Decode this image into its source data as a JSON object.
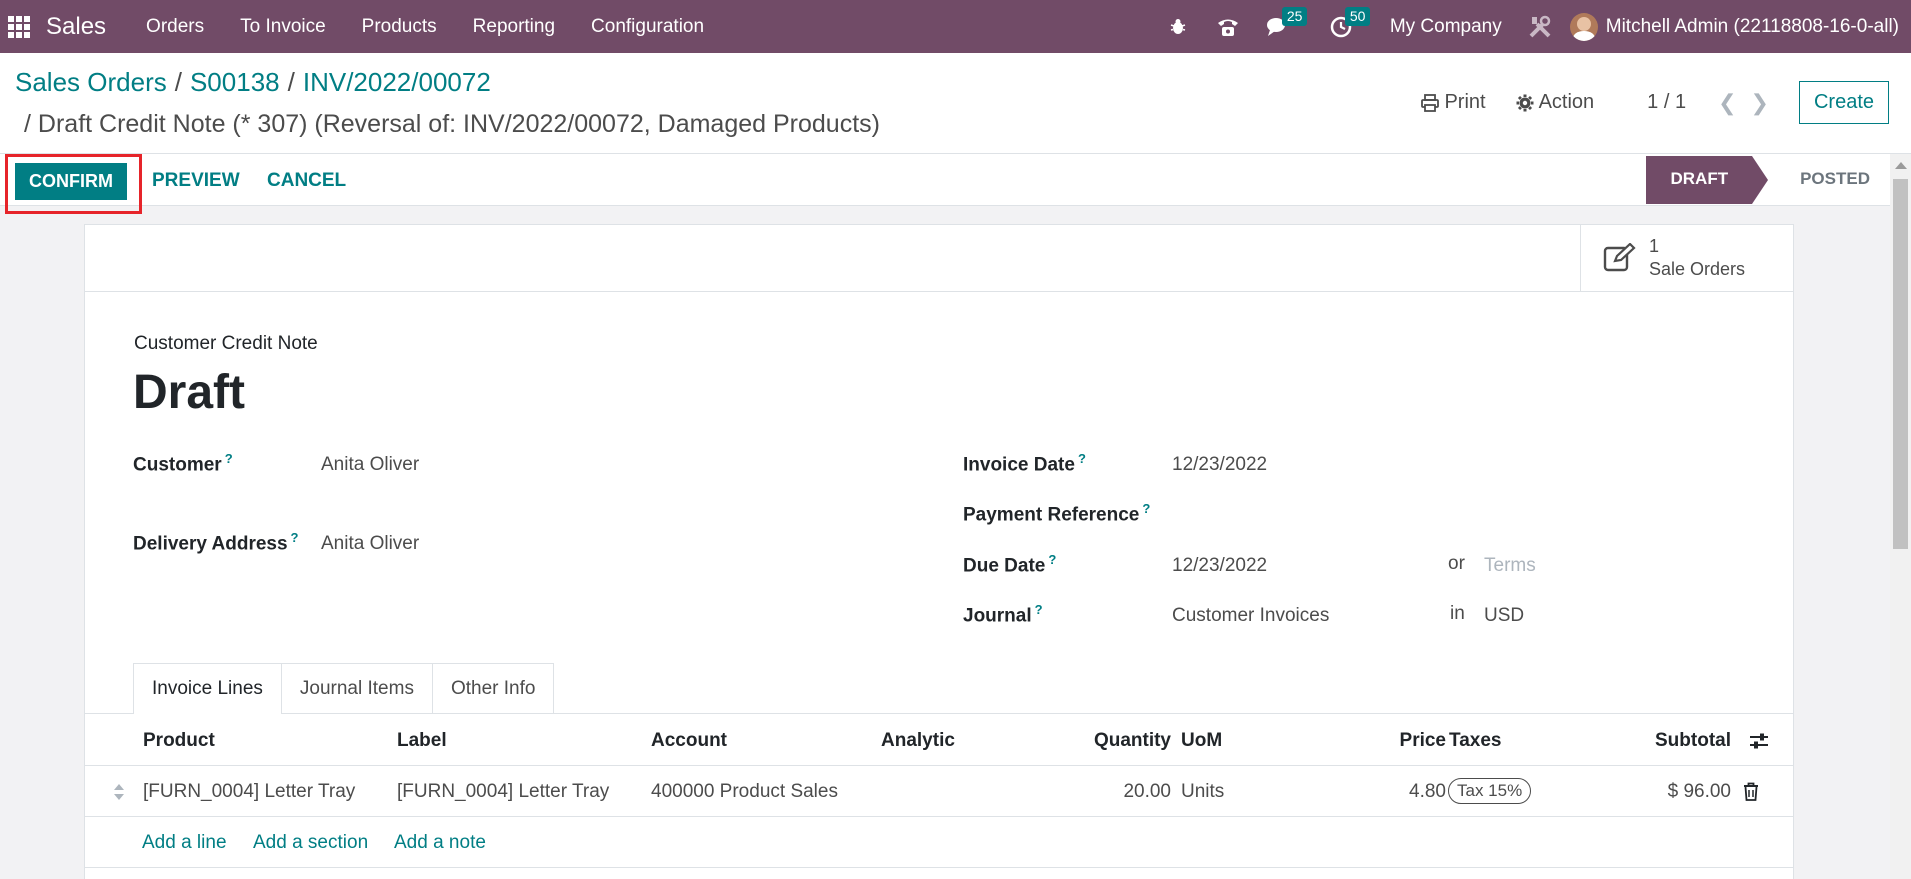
{
  "navbar": {
    "brand": "Sales",
    "menu": [
      "Orders",
      "To Invoice",
      "Products",
      "Reporting",
      "Configuration"
    ],
    "messages_count": "25",
    "activities_count": "50",
    "company": "My Company",
    "user": "Mitchell Admin (22118808-16-0-all)",
    "bg_color": "#714b67"
  },
  "breadcrumb": {
    "items": [
      "Sales Orders",
      "S00138",
      "INV/2022/00072"
    ],
    "current": "Draft Credit Note (* 307) (Reversal of: INV/2022/00072, Damaged Products)"
  },
  "control": {
    "print_label": "Print",
    "action_label": "Action",
    "pager": "1 / 1",
    "create_label": "Create"
  },
  "statusbar": {
    "confirm_label": "CONFIRM",
    "preview_label": "PREVIEW",
    "cancel_label": "CANCEL",
    "stage_active": "DRAFT",
    "stage_next": "POSTED"
  },
  "smart_button": {
    "count": "1",
    "label": "Sale Orders"
  },
  "form": {
    "doc_type": "Customer Credit Note",
    "title": "Draft",
    "customer_label": "Customer",
    "customer_value": "Anita Oliver",
    "delivery_label": "Delivery Address",
    "delivery_value": "Anita Oliver",
    "invoice_date_label": "Invoice Date",
    "invoice_date_value": "12/23/2022",
    "payment_ref_label": "Payment Reference",
    "due_date_label": "Due Date",
    "due_date_value": "12/23/2022",
    "or_label": "or",
    "terms_placeholder": "Terms",
    "journal_label": "Journal",
    "journal_value": "Customer Invoices",
    "in_label": "in",
    "currency_value": "USD",
    "help_mark": "?"
  },
  "tabs": [
    "Invoice Lines",
    "Journal Items",
    "Other Info"
  ],
  "lines": {
    "headers": {
      "product": "Product",
      "label": "Label",
      "account": "Account",
      "analytic": "Analytic",
      "quantity": "Quantity",
      "uom": "UoM",
      "price": "Price",
      "taxes": "Taxes",
      "subtotal": "Subtotal"
    },
    "rows": [
      {
        "product": "[FURN_0004] Letter Tray",
        "label": "[FURN_0004] Letter Tray",
        "account": "400000 Product Sales",
        "analytic": "",
        "quantity": "20.00",
        "uom": "Units",
        "price": "4.80",
        "taxes": "Tax 15%",
        "subtotal": "$ 96.00"
      }
    ],
    "add_line": "Add a line",
    "add_section": "Add a section",
    "add_note": "Add a note"
  }
}
